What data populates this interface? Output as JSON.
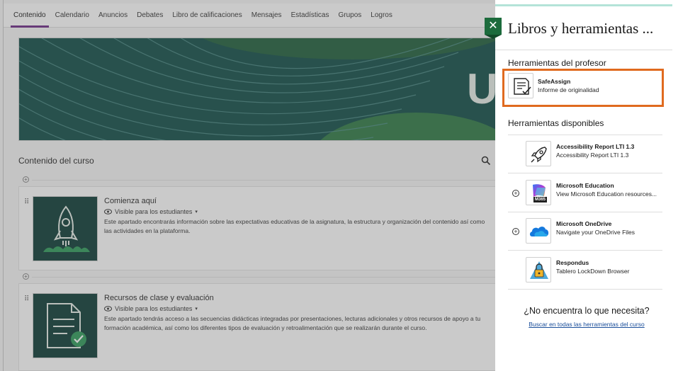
{
  "course_nav": {
    "tabs": [
      {
        "label": "Contenido",
        "active": true
      },
      {
        "label": "Calendario"
      },
      {
        "label": "Anuncios"
      },
      {
        "label": "Debates"
      },
      {
        "label": "Libro de calificaciones"
      },
      {
        "label": "Mensajes"
      },
      {
        "label": "Estadísticas"
      },
      {
        "label": "Grupos"
      },
      {
        "label": "Logros"
      }
    ]
  },
  "banner": {
    "letter": "U"
  },
  "content": {
    "section_title": "Contenido del curso",
    "items": [
      {
        "title": "Comienza aquí",
        "visibility": "Visible para los estudiantes",
        "description": "Este apartado encontrarás información sobre las expectativas educativas de la asignatura, la estructura y organización del contenido así como las actividades en la plataforma."
      },
      {
        "title": "Recursos de clase y evaluación",
        "visibility": "Visible para los estudiantes",
        "description": "Este apartado tendrás acceso a las secuencias didácticas integradas por presentaciones, lecturas adicionales y otros recursos de apoyo a tu formación académica, así como los diferentes tipos de evaluación y retroalimentación que se realizarán durante el curso."
      }
    ]
  },
  "panel": {
    "title": "Libros y herramientas ...",
    "close_label": "✕",
    "teacher_tools_title": "Herramientas del profesor",
    "teacher_tools": [
      {
        "name": "SafeAssign",
        "subtitle": "Informe de originalidad",
        "icon": "document-check-icon"
      }
    ],
    "available_tools_title": "Herramientas disponibles",
    "available_tools": [
      {
        "name": "Accessibility Report LTI 1.3",
        "subtitle": "Accessibility Report LTI 1.3",
        "icon": "rocket-icon",
        "addable": false
      },
      {
        "name": "Microsoft Education",
        "subtitle": "View Microsoft Education resources...",
        "icon": "m365-icon",
        "badge": "M365",
        "addable": true
      },
      {
        "name": "Microsoft OneDrive",
        "subtitle": "Navigate your OneDrive Files",
        "icon": "onedrive-cloud-icon",
        "addable": true
      },
      {
        "name": "Respondus",
        "subtitle": "Tablero LockDown Browser",
        "icon": "respondus-lock-icon",
        "addable": false
      }
    ],
    "help_title": "¿No encuentra lo que necesita?",
    "help_link": "Buscar en todas las herramientas del curso"
  },
  "colors": {
    "accent_tab": "#6e2c87",
    "banner_green": "#114d47",
    "close_green": "#1c6b3c",
    "highlight_orange": "#e06a1f",
    "link_blue": "#1a4e9a"
  }
}
